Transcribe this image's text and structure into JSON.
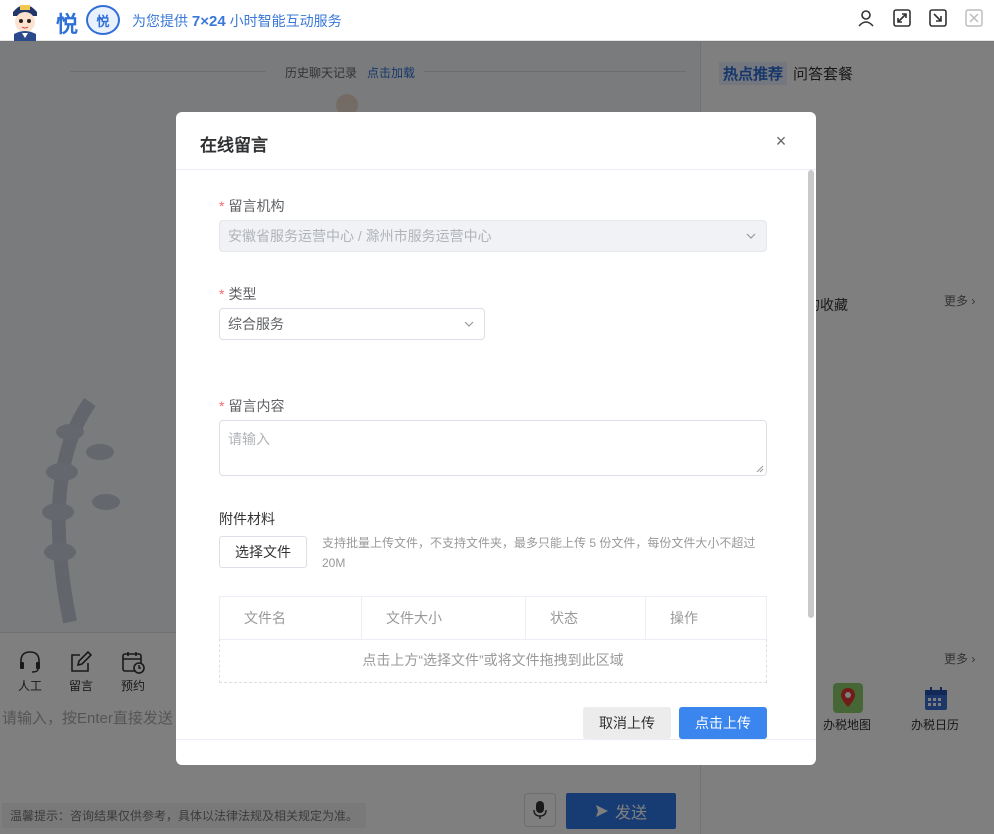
{
  "header": {
    "logo_char": "悦",
    "badge_char": "悦",
    "slogan_prefix": "为您提供 ",
    "slogan_bold": "7×24",
    "slogan_suffix": " 小时智能互动服务"
  },
  "chat": {
    "history_label": "历史聊天记录",
    "history_load": "点击加载"
  },
  "right_panel": {
    "tabs": [
      "热点推荐",
      "问答套餐"
    ],
    "favorites_title": "的收藏",
    "more1": "更多 ›",
    "more2": "更多 ›",
    "tools": [
      {
        "label": "办税地图",
        "icon": "map-pin-icon"
      },
      {
        "label": "办税日历",
        "icon": "calendar-icon"
      }
    ]
  },
  "bottom": {
    "tools": [
      {
        "label": "人工",
        "icon": "headset-icon"
      },
      {
        "label": "留言",
        "icon": "edit-icon"
      },
      {
        "label": "预约",
        "icon": "calendar-clock-icon"
      }
    ],
    "input_placeholder": "请输入，按Enter直接发送",
    "tip": "温馨提示：咨询结果仅供参考，具体以法律法规及相关规定为准。",
    "send_label": "发送"
  },
  "dialog": {
    "title": "在线留言",
    "close": "×",
    "org_label": "留言机构",
    "org_value": "安徽省服务运营中心 / 滁州市服务运营中心",
    "type_label": "类型",
    "type_value": "综合服务",
    "content_label": "留言内容",
    "content_placeholder": "请输入",
    "attach_label": "附件材料",
    "file_button": "选择文件",
    "file_hint": "支持批量上传文件，不支持文件夹，最多只能上传 5 份文件，每份文件大小不超过 20M",
    "table_headers": [
      "文件名",
      "文件大小",
      "状态",
      "操作"
    ],
    "table_empty": "点击上方“选择文件”或将文件拖拽到此区域",
    "cancel_upload": "取消上传",
    "confirm_upload": "点击上传"
  },
  "colors": {
    "primary": "#3a86ee",
    "required": "#f56c6c",
    "brand": "#2f6fd6"
  }
}
